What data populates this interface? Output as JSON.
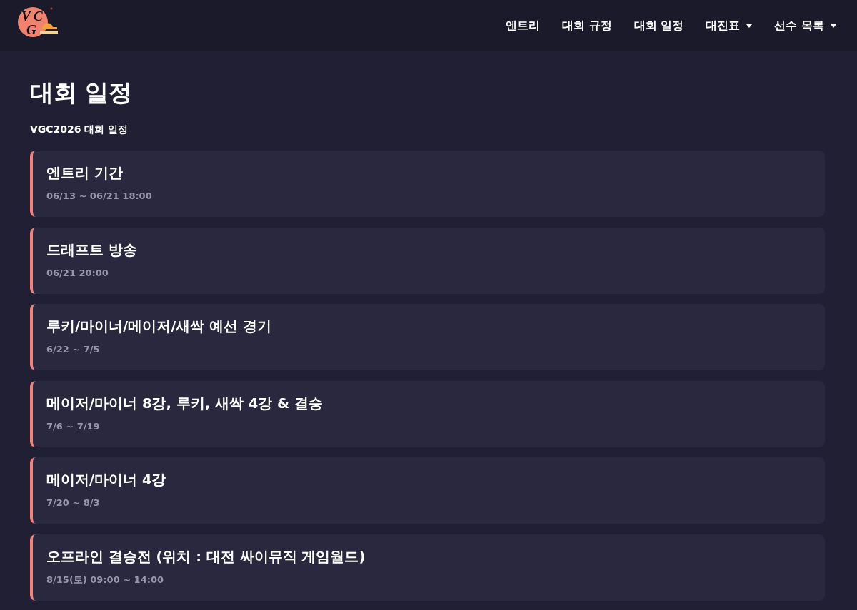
{
  "header": {
    "logo": {
      "text": "VGC"
    },
    "nav": [
      {
        "label": "엔트리",
        "kind": "link"
      },
      {
        "label": "대회 규정",
        "kind": "link"
      },
      {
        "label": "대회 일정",
        "kind": "link"
      },
      {
        "label": "대진표",
        "kind": "dropdown"
      },
      {
        "label": "선수 목록",
        "kind": "dropdown"
      }
    ]
  },
  "page": {
    "title": "대회 일정",
    "subtitle": "VGC2026 대회 일정"
  },
  "schedule": [
    {
      "title": "엔트리 기간",
      "date": "06/13 ~ 06/21 18:00"
    },
    {
      "title": "드래프트 방송",
      "date": "06/21 20:00"
    },
    {
      "title": "루키/마이너/메이저/새싹 예선 경기",
      "date": "6/22 ~ 7/5"
    },
    {
      "title": "메이저/마이너 8강, 루키, 새싹 4강 & 결승",
      "date": "7/6 ~ 7/19"
    },
    {
      "title": "메이저/마이너 4강",
      "date": "7/20 ~ 8/3"
    },
    {
      "title": "오프라인 결승전 (위치 : 대전 싸이뮤직 게임월드)",
      "date": "8/15(토) 09:00 ~ 14:00"
    }
  ]
}
